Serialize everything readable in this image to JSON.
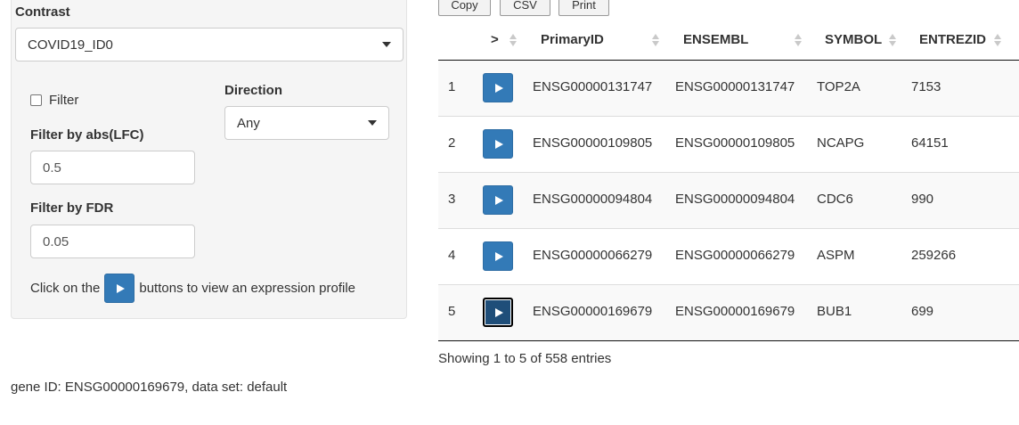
{
  "sidebar": {
    "contrast_label": "Contrast",
    "contrast_value": "COVID19_ID0",
    "filter_label": "Filter",
    "direction_label": "Direction",
    "direction_value": "Any",
    "lfc_label": "Filter by abs(LFC)",
    "lfc_value": "0.5",
    "fdr_label": "Filter by FDR",
    "fdr_value": "0.05",
    "help_prefix": "Click on the",
    "help_suffix": "buttons to view an expression profile"
  },
  "toolbar": {
    "copy": "Copy",
    "csv": "CSV",
    "print": "Print"
  },
  "table": {
    "columns": [
      ">",
      "PrimaryID",
      "ENSEMBL",
      "SYMBOL",
      "ENTREZID"
    ],
    "rows": [
      {
        "index": "1",
        "primary": "ENSG00000131747",
        "ensembl": "ENSG00000131747",
        "symbol": "TOP2A",
        "entrez": "7153"
      },
      {
        "index": "2",
        "primary": "ENSG00000109805",
        "ensembl": "ENSG00000109805",
        "symbol": "NCAPG",
        "entrez": "64151"
      },
      {
        "index": "3",
        "primary": "ENSG00000094804",
        "ensembl": "ENSG00000094804",
        "symbol": "CDC6",
        "entrez": "990"
      },
      {
        "index": "4",
        "primary": "ENSG00000066279",
        "ensembl": "ENSG00000066279",
        "symbol": "ASPM",
        "entrez": "259266"
      },
      {
        "index": "5",
        "primary": "ENSG00000169679",
        "ensembl": "ENSG00000169679",
        "symbol": "BUB1",
        "entrez": "699"
      }
    ],
    "info": "Showing 1 to 5 of 558 entries"
  },
  "footer": {
    "text": "gene ID: ENSG00000169679, data set: default"
  },
  "colors": {
    "primary_button": "#337ab7",
    "well_background": "#f5f5f5",
    "stripe": "#f9f9f9"
  }
}
